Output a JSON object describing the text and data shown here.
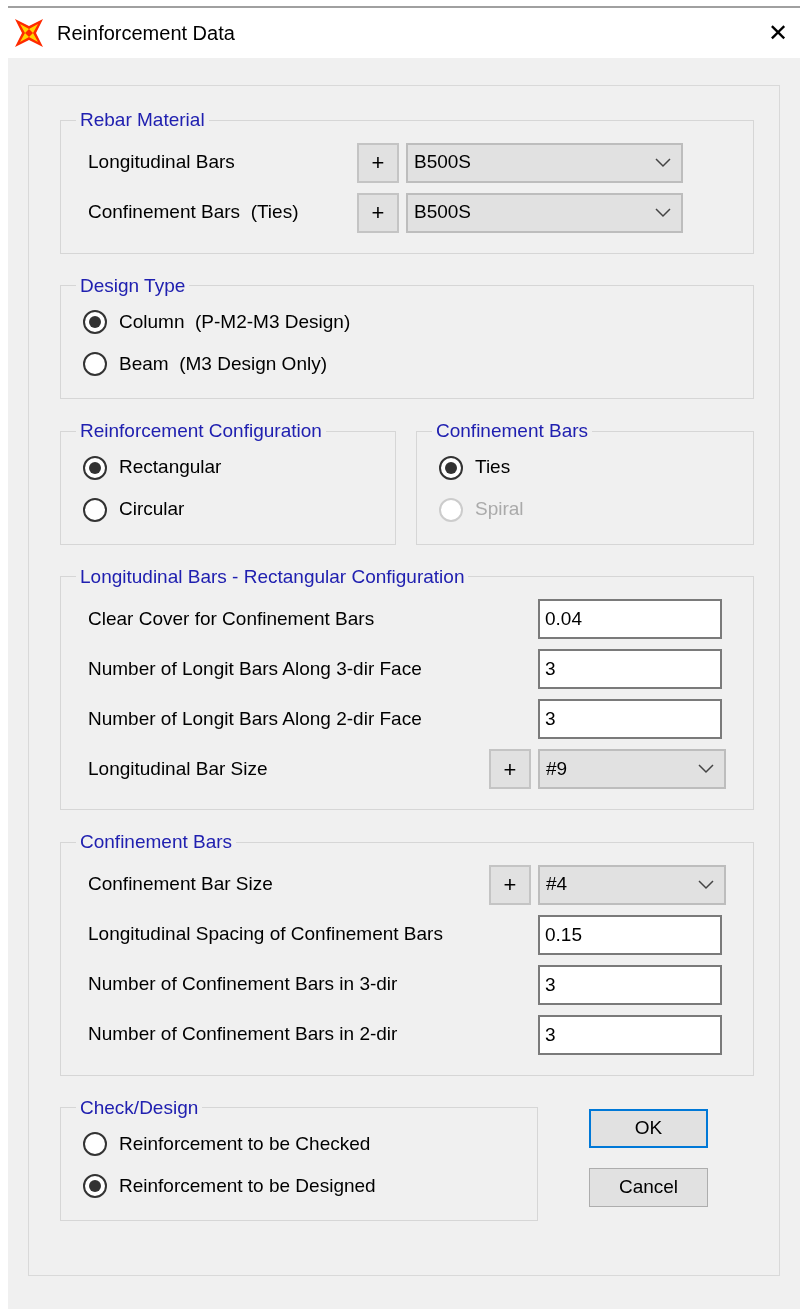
{
  "window": {
    "title": "Reinforcement Data",
    "close": "✕"
  },
  "rebar_material": {
    "title": "Rebar Material",
    "rows": [
      {
        "kind": "dropdown",
        "label": "Longitudinal Bars  ",
        "add_button": "+",
        "value": "B500S"
      },
      {
        "kind": "dropdown",
        "label": "Confinement Bars  (Ties)",
        "add_button": "+",
        "value": "B500S"
      }
    ]
  },
  "design_type": {
    "title": "Design Type",
    "options": [
      {
        "label": "Column  (P-M2-M3 Design)",
        "selected": true,
        "disabled": false
      },
      {
        "label": "Beam  (M3 Design Only)",
        "selected": false,
        "disabled": false
      }
    ]
  },
  "reinforcement_configuration": {
    "title": "Reinforcement Configuration",
    "options": [
      {
        "label": "Rectangular",
        "selected": true,
        "disabled": false
      },
      {
        "label": "Circular",
        "selected": false,
        "disabled": false
      }
    ]
  },
  "confinement_bar_type": {
    "title": "Confinement Bars",
    "options": [
      {
        "label": "Ties",
        "selected": true,
        "disabled": false
      },
      {
        "label": "Spiral",
        "selected": false,
        "disabled": true
      }
    ]
  },
  "longitudinal_bars": {
    "title": "Longitudinal Bars - Rectangular Configuration",
    "rows": [
      {
        "kind": "field",
        "label": "Clear Cover for Confinement Bars",
        "value": "0.04"
      },
      {
        "kind": "field",
        "label": "Number of Longit Bars Along 3-dir Face",
        "value": "3"
      },
      {
        "kind": "field",
        "label": "Number of Longit Bars Along 2-dir Face",
        "value": "3"
      },
      {
        "kind": "dropdown",
        "label": "Longitudinal Bar Size",
        "add_button": "+",
        "value": "#9"
      }
    ]
  },
  "confinement_bars": {
    "title": "Confinement Bars",
    "rows": [
      {
        "kind": "dropdown",
        "label": "Confinement Bar Size",
        "add_button": "+",
        "value": "#4"
      },
      {
        "kind": "field",
        "label": "Longitudinal Spacing of Confinement Bars",
        "value": "0.15"
      },
      {
        "kind": "field",
        "label": "Number of Confinement Bars in 3-dir",
        "value": "3"
      },
      {
        "kind": "field",
        "label": "Number of Confinement Bars in 2-dir",
        "value": "3"
      }
    ]
  },
  "check_design": {
    "title": "Check/Design",
    "options": [
      {
        "label": "Reinforcement to be Checked",
        "selected": false,
        "disabled": false
      },
      {
        "label": "Reinforcement to be Designed",
        "selected": true,
        "disabled": false
      }
    ]
  },
  "buttons": [
    {
      "label": "OK",
      "default": true
    },
    {
      "label": "Cancel",
      "default": false
    }
  ]
}
